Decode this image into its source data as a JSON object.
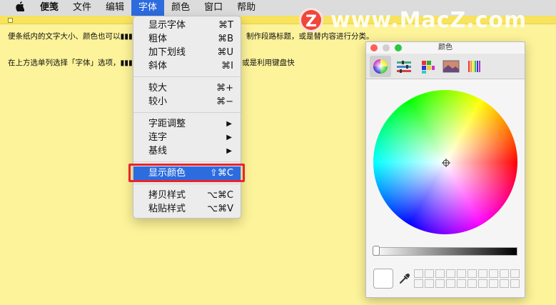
{
  "menubar": {
    "apple": "",
    "items": [
      "便笺",
      "文件",
      "编辑",
      "字体",
      "颜色",
      "窗口",
      "帮助"
    ]
  },
  "note": {
    "line1": "便条纸内的文字大小、颜色也可以▮▮▮▮▮▮▮▮▮▮▮▮▮▮▮▮纸内的重点内容、制作段路标题，或是替内容进行分类。",
    "line2": "在上方选单列选择「字体」选项，▮▮▮▮▮▮▮▮▮▮▮▮▮▮▮开启字体编辑器，或是利用键盘快"
  },
  "font_menu": {
    "items": [
      {
        "label": "显示字体",
        "shortcut": "⌘T"
      },
      {
        "label": "粗体",
        "shortcut": "⌘B"
      },
      {
        "label": "加下划线",
        "shortcut": "⌘U"
      },
      {
        "label": "斜体",
        "shortcut": "⌘I"
      },
      {
        "label": "较大",
        "shortcut": "⌘+"
      },
      {
        "label": "较小",
        "shortcut": "⌘−"
      },
      {
        "label": "字距调整",
        "shortcut": "▶"
      },
      {
        "label": "连字",
        "shortcut": "▶"
      },
      {
        "label": "基线",
        "shortcut": "▶"
      },
      {
        "label": "显示颜色",
        "shortcut": "⇧⌘C"
      },
      {
        "label": "拷贝样式",
        "shortcut": "⌥⌘C"
      },
      {
        "label": "粘贴样式",
        "shortcut": "⌥⌘V"
      }
    ],
    "highlighted": "显示颜色"
  },
  "watermark": {
    "logo": "Z",
    "text": "www.MacZ.com"
  },
  "color_panel": {
    "title": "颜色",
    "tabs": [
      "color-wheel-icon",
      "sliders-icon",
      "palettes-icon",
      "image-palettes-icon",
      "pencils-icon"
    ],
    "selected_tab": "color-wheel-icon",
    "brightness": 0.0,
    "current_color": "#ffffff"
  },
  "colors": {
    "menu_highlight": "#2d6cdf",
    "note_bg": "#fdf39a",
    "callout": "#e8242c"
  }
}
